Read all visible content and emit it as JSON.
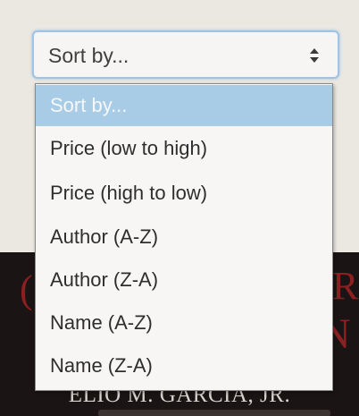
{
  "sort_select": {
    "current_value": "Sort by...",
    "options": [
      "Sort by...",
      "Price (low to high)",
      "Price (high to low)",
      "Author (A-Z)",
      "Author (Z-A)",
      "Name (A-Z)",
      "Name (Z-A)"
    ],
    "highlighted_option": "Sort by...",
    "icon": "up-down-arrows-icon"
  },
  "background": {
    "book_author": "ELIO M. GARCIA, JR."
  },
  "colors": {
    "focus_border": "#9fc3e6",
    "highlight": "#a9cce6",
    "cover_dark": "#1b1414",
    "cover_red": "#8c1f21"
  }
}
